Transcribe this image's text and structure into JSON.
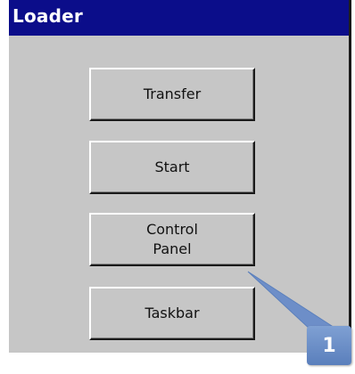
{
  "window": {
    "title": "Loader"
  },
  "buttons": {
    "transfer": "Transfer",
    "start": "Start",
    "control_panel": "Control\nPanel",
    "taskbar": "Taskbar"
  },
  "callout": {
    "number": "1"
  },
  "colors": {
    "titlebar": "#0b0d8a",
    "window_bg": "#c6c6c6",
    "callout": "#6d8ec8"
  }
}
